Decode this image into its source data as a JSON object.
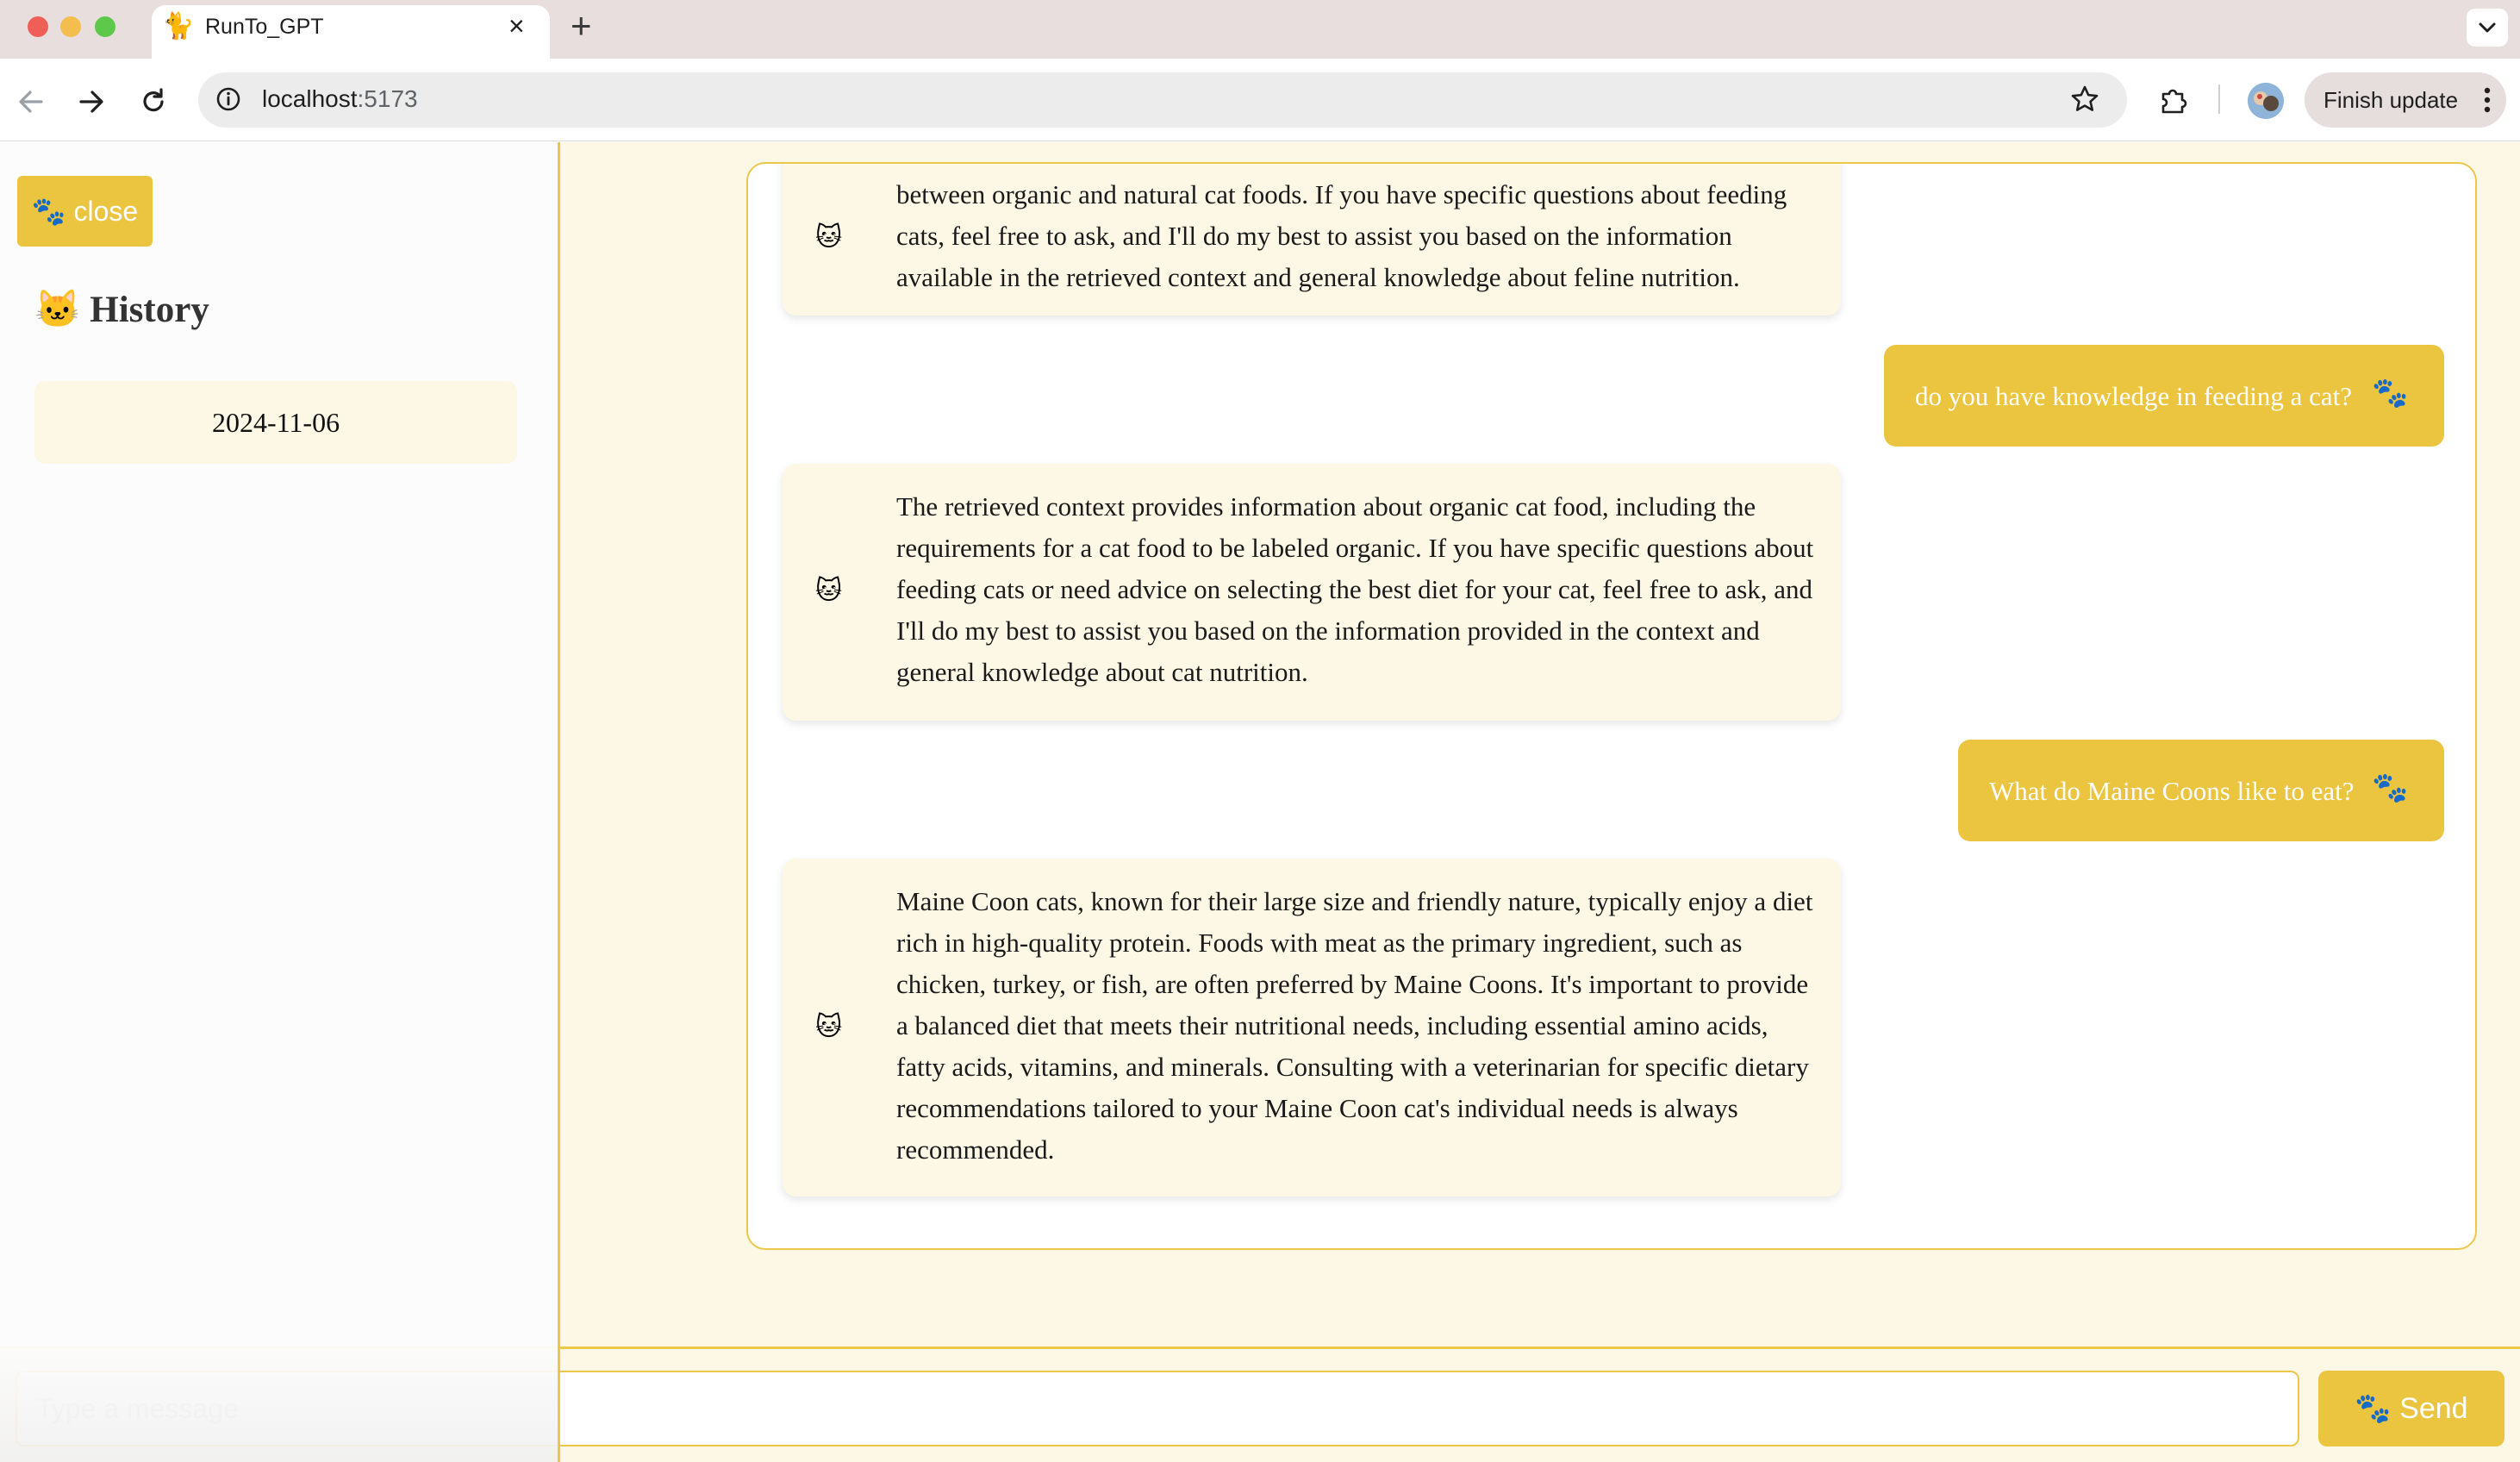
{
  "browser": {
    "tab_title": "RunTo_GPT",
    "tab_favicon": "🐈",
    "url_host": "localhost",
    "url_port": ":5173",
    "finish_update_label": "Finish update"
  },
  "sidebar": {
    "close_label": "🐾 close",
    "history_title": "🐱 History",
    "history_items": [
      "2024-11-06"
    ]
  },
  "chat": {
    "bot_avatar": "🐱",
    "user_paw": "🐾",
    "messages": [
      {
        "role": "assistant",
        "lines": [
          "between organic and natural cat foods. If you have specific questions about feeding",
          "cats, feel free to ask, and I'll do my best to assist you based on the information",
          "available in the retrieved context and general knowledge about feline nutrition."
        ]
      },
      {
        "role": "user",
        "text": "do you have knowledge in feeding a cat?"
      },
      {
        "role": "assistant",
        "lines": [
          "The retrieved context provides information about organic cat food, including the",
          "requirements for a cat food to be labeled organic. If you have specific questions about",
          "feeding cats or need advice on selecting the best diet for your cat, feel free to ask, and",
          "I'll do my best to assist you based on the information provided in the context and",
          "general knowledge about cat nutrition."
        ]
      },
      {
        "role": "user",
        "text": "What do Maine Coons like to eat?"
      },
      {
        "role": "assistant",
        "lines": [
          "Maine Coon cats, known for their large size and friendly nature, typically enjoy a diet",
          "rich in high-quality protein. Foods with meat as the primary ingredient, such as",
          "chicken, turkey, or fish, are often preferred by Maine Coons. It's important to provide",
          "a balanced diet that meets their nutritional needs, including essential amino acids,",
          "fatty acids, vitamins, and minerals. Consulting with a veterinarian for specific dietary",
          "recommendations tailored to your Maine Coon cat's individual needs is always",
          "recommended."
        ]
      }
    ]
  },
  "composer": {
    "placeholder": "Type a message",
    "value": "",
    "send_label": "🐾 Send"
  },
  "colors": {
    "accent": "#ecc540",
    "accent_border": "#ecc84a",
    "cream": "#fdf7e6"
  }
}
